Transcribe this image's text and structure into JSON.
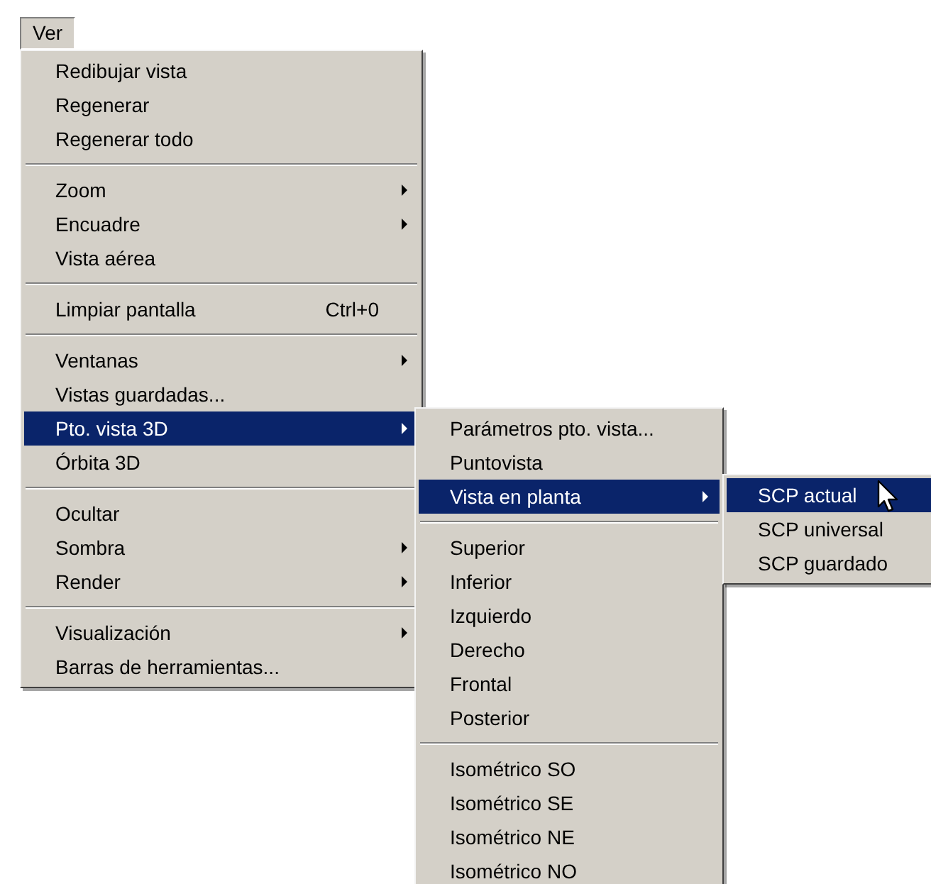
{
  "menu_bar": [
    {
      "label": "Ver",
      "selected": true
    }
  ],
  "menus": [
    {
      "items": [
        {
          "kind": "item",
          "label": "Redibujar vista",
          "has_submenu": false,
          "selected": false
        },
        {
          "kind": "item",
          "label": "Regenerar",
          "has_submenu": false,
          "selected": false
        },
        {
          "kind": "item",
          "label": "Regenerar todo",
          "has_submenu": false,
          "selected": false
        },
        {
          "kind": "separator"
        },
        {
          "kind": "item",
          "label": "Zoom",
          "has_submenu": true,
          "selected": false
        },
        {
          "kind": "item",
          "label": "Encuadre",
          "has_submenu": true,
          "selected": false
        },
        {
          "kind": "item",
          "label": "Vista aérea",
          "has_submenu": false,
          "selected": false
        },
        {
          "kind": "separator"
        },
        {
          "kind": "item",
          "label": "Limpiar pantalla",
          "shortcut": "Ctrl+0",
          "has_submenu": false,
          "selected": false
        },
        {
          "kind": "separator"
        },
        {
          "kind": "item",
          "label": "Ventanas",
          "has_submenu": true,
          "selected": false
        },
        {
          "kind": "item",
          "label": "Vistas guardadas...",
          "has_submenu": false,
          "selected": false
        },
        {
          "kind": "item",
          "label": "Pto. vista 3D",
          "has_submenu": true,
          "selected": true
        },
        {
          "kind": "item",
          "label": "Órbita 3D",
          "has_submenu": false,
          "selected": false
        },
        {
          "kind": "separator"
        },
        {
          "kind": "item",
          "label": "Ocultar",
          "has_submenu": false,
          "selected": false
        },
        {
          "kind": "item",
          "label": "Sombra",
          "has_submenu": true,
          "selected": false
        },
        {
          "kind": "item",
          "label": "Render",
          "has_submenu": true,
          "selected": false
        },
        {
          "kind": "separator"
        },
        {
          "kind": "item",
          "label": "Visualización",
          "has_submenu": true,
          "selected": false
        },
        {
          "kind": "item",
          "label": "Barras de herramientas...",
          "has_submenu": false,
          "selected": false
        }
      ]
    },
    {
      "items": [
        {
          "kind": "item",
          "label": "Parámetros pto. vista...",
          "has_submenu": false,
          "selected": false
        },
        {
          "kind": "item",
          "label": "Puntovista",
          "has_submenu": false,
          "selected": false
        },
        {
          "kind": "item",
          "label": "Vista en planta",
          "has_submenu": true,
          "selected": true
        },
        {
          "kind": "separator"
        },
        {
          "kind": "item",
          "label": "Superior",
          "has_submenu": false,
          "selected": false
        },
        {
          "kind": "item",
          "label": "Inferior",
          "has_submenu": false,
          "selected": false
        },
        {
          "kind": "item",
          "label": "Izquierdo",
          "has_submenu": false,
          "selected": false
        },
        {
          "kind": "item",
          "label": "Derecho",
          "has_submenu": false,
          "selected": false
        },
        {
          "kind": "item",
          "label": "Frontal",
          "has_submenu": false,
          "selected": false
        },
        {
          "kind": "item",
          "label": "Posterior",
          "has_submenu": false,
          "selected": false
        },
        {
          "kind": "separator"
        },
        {
          "kind": "item",
          "label": "Isométrico SO",
          "has_submenu": false,
          "selected": false
        },
        {
          "kind": "item",
          "label": "Isométrico SE",
          "has_submenu": false,
          "selected": false
        },
        {
          "kind": "item",
          "label": "Isométrico NE",
          "has_submenu": false,
          "selected": false
        },
        {
          "kind": "item",
          "label": "Isométrico NO",
          "has_submenu": false,
          "selected": false
        }
      ]
    },
    {
      "items": [
        {
          "kind": "item",
          "label": "SCP actual",
          "has_submenu": false,
          "selected": true
        },
        {
          "kind": "item",
          "label": "SCP universal",
          "has_submenu": false,
          "selected": false
        },
        {
          "kind": "item",
          "label": "SCP guardado",
          "has_submenu": false,
          "selected": false
        }
      ]
    }
  ]
}
